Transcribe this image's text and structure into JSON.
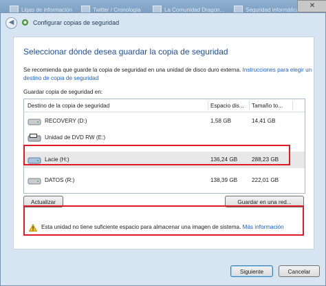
{
  "taskbar": {
    "tabs": [
      {
        "label": "Ligas de información"
      },
      {
        "label": "Twitter / Cronología"
      },
      {
        "label": "La Comunidad Dragon..."
      },
      {
        "label": "Seguridad informática..."
      }
    ],
    "close_symbol": "✕"
  },
  "window": {
    "title": "Configurar copias de seguridad",
    "back_symbol": "◀"
  },
  "main": {
    "heading": "Seleccionar dónde desea guardar la copia de seguridad",
    "description": "Se recomienda que guarde la copia de seguridad en una unidad de disco duro externa.",
    "description_link": "Instrucciones para elegir un destino de copia de seguridad",
    "list_label": "Guardar copia de seguridad en:"
  },
  "table": {
    "headers": [
      "Destino de la copia de seguridad",
      "Espacio dis...",
      "Tamaño to..."
    ],
    "rows": [
      {
        "name": "RECOVERY (D:)",
        "free": "1,58 GB",
        "total": "14,41 GB",
        "icon": "hard-drive-icon"
      },
      {
        "name": "Unidad de DVD RW (E:)",
        "free": "",
        "total": "",
        "icon": "dvd-drive-icon"
      },
      {
        "name": "Lacie (H:)",
        "free": "136,24 GB",
        "total": "288,23 GB",
        "icon": "removable-drive-icon",
        "selected": true
      },
      {
        "name": "DATOS (R:)",
        "free": "138,39 GB",
        "total": "222,01 GB",
        "icon": "hard-drive-icon"
      }
    ]
  },
  "buttons": {
    "refresh": "Actualizar",
    "save_network": "Guardar en una red...",
    "next": "Siguiente",
    "cancel": "Cancelar"
  },
  "warning": {
    "text": "Esta unidad no tiene suficiente espacio para almacenar una imagen de sistema.",
    "link": "Más información"
  },
  "colors": {
    "highlight": "#e01a22",
    "heading": "#1e4fa0",
    "link": "#1a5fd0"
  }
}
